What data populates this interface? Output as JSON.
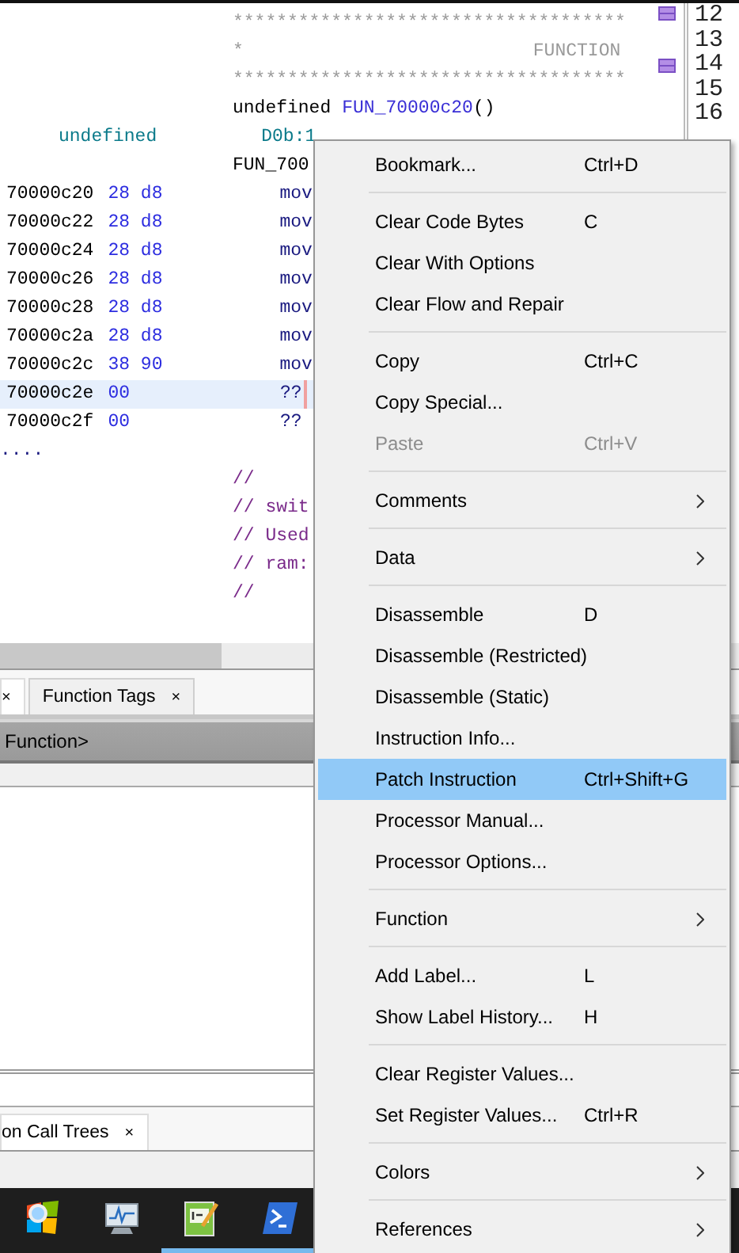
{
  "listing": {
    "rows": [
      {
        "kind": "stars",
        "text": "************************************"
      },
      {
        "kind": "banner",
        "left": "*",
        "title": "FUNCTION"
      },
      {
        "kind": "stars",
        "text": "************************************"
      },
      {
        "kind": "signature",
        "type": "undefined",
        "name": "FUN_70000c20",
        "suffix": "()"
      },
      {
        "kind": "param",
        "type": "undefined",
        "storage": "D0b:1"
      },
      {
        "kind": "label",
        "text": "FUN_700"
      },
      {
        "kind": "instr",
        "address": "70000c20",
        "bytes": "28 d8",
        "mnemonic": "mov",
        "selected": false
      },
      {
        "kind": "instr",
        "address": "70000c22",
        "bytes": "28 d8",
        "mnemonic": "mov",
        "selected": false
      },
      {
        "kind": "instr",
        "address": "70000c24",
        "bytes": "28 d8",
        "mnemonic": "mov",
        "selected": false
      },
      {
        "kind": "instr",
        "address": "70000c26",
        "bytes": "28 d8",
        "mnemonic": "mov",
        "selected": false
      },
      {
        "kind": "instr",
        "address": "70000c28",
        "bytes": "28 d8",
        "mnemonic": "mov",
        "selected": false
      },
      {
        "kind": "instr",
        "address": "70000c2a",
        "bytes": "28 d8",
        "mnemonic": "mov",
        "selected": false
      },
      {
        "kind": "instr",
        "address": "70000c2c",
        "bytes": "38 90",
        "mnemonic": "mov",
        "selected": false
      },
      {
        "kind": "instr",
        "address": "70000c2e",
        "bytes": "00",
        "mnemonic": "??",
        "selected": true
      },
      {
        "kind": "instr",
        "address": "70000c2f",
        "bytes": "00",
        "mnemonic": "??",
        "selected": false
      },
      {
        "kind": "ellipsis",
        "text": "...."
      },
      {
        "kind": "comment",
        "text": "//"
      },
      {
        "kind": "comment",
        "text": "// swit"
      },
      {
        "kind": "comment",
        "text": "// Used"
      },
      {
        "kind": "comment",
        "text": "// ram:"
      },
      {
        "kind": "comment",
        "text": "//"
      }
    ],
    "line_numbers": [
      "12",
      "13",
      "14",
      "15",
      "16"
    ]
  },
  "upper_tabs": [
    {
      "close": "×",
      "selected": true
    },
    {
      "label": "Function Tags",
      "close": "×",
      "selected": false
    }
  ],
  "function_header": "Function>",
  "lower_tabs": [
    {
      "label": "on Call Trees",
      "close": "×",
      "selected": true
    }
  ],
  "taskbar": [
    {
      "kind": "start",
      "running": false
    },
    {
      "kind": "monitor",
      "running": false
    },
    {
      "kind": "notepad",
      "running": true
    },
    {
      "kind": "shell",
      "running": true
    }
  ],
  "context_menu": [
    {
      "kind": "item",
      "label": "Bookmark...",
      "shortcut": "Ctrl+D",
      "submenu": false,
      "disabled": false,
      "selected": false
    },
    {
      "kind": "separator"
    },
    {
      "kind": "item",
      "label": "Clear Code Bytes",
      "shortcut": "C",
      "submenu": false,
      "disabled": false,
      "selected": false
    },
    {
      "kind": "item",
      "label": "Clear With Options",
      "submenu": false,
      "disabled": false,
      "selected": false
    },
    {
      "kind": "item",
      "label": "Clear Flow and Repair",
      "submenu": false,
      "disabled": false,
      "selected": false
    },
    {
      "kind": "separator"
    },
    {
      "kind": "item",
      "label": "Copy",
      "shortcut": "Ctrl+C",
      "submenu": false,
      "disabled": false,
      "selected": false
    },
    {
      "kind": "item",
      "label": "Copy Special...",
      "submenu": false,
      "disabled": false,
      "selected": false
    },
    {
      "kind": "item",
      "label": "Paste",
      "shortcut": "Ctrl+V",
      "submenu": false,
      "disabled": true,
      "selected": false
    },
    {
      "kind": "separator"
    },
    {
      "kind": "item",
      "label": "Comments",
      "submenu": true,
      "disabled": false,
      "selected": false
    },
    {
      "kind": "separator"
    },
    {
      "kind": "item",
      "label": "Data",
      "submenu": true,
      "disabled": false,
      "selected": false
    },
    {
      "kind": "separator"
    },
    {
      "kind": "item",
      "label": "Disassemble",
      "shortcut": "D",
      "submenu": false,
      "disabled": false,
      "selected": false
    },
    {
      "kind": "item",
      "label": "Disassemble (Restricted)",
      "submenu": false,
      "disabled": false,
      "selected": false
    },
    {
      "kind": "item",
      "label": "Disassemble (Static)",
      "submenu": false,
      "disabled": false,
      "selected": false
    },
    {
      "kind": "item",
      "label": "Instruction Info...",
      "submenu": false,
      "disabled": false,
      "selected": false
    },
    {
      "kind": "item",
      "label": "Patch Instruction",
      "shortcut": "Ctrl+Shift+G",
      "submenu": false,
      "disabled": false,
      "selected": true
    },
    {
      "kind": "item",
      "label": "Processor Manual...",
      "submenu": false,
      "disabled": false,
      "selected": false
    },
    {
      "kind": "item",
      "label": "Processor Options...",
      "submenu": false,
      "disabled": false,
      "selected": false
    },
    {
      "kind": "separator"
    },
    {
      "kind": "item",
      "label": "Function",
      "submenu": true,
      "disabled": false,
      "selected": false
    },
    {
      "kind": "separator"
    },
    {
      "kind": "item",
      "label": "Add Label...",
      "shortcut": "L",
      "submenu": false,
      "disabled": false,
      "selected": false
    },
    {
      "kind": "item",
      "label": "Show Label History...",
      "shortcut": "H",
      "submenu": false,
      "disabled": false,
      "selected": false
    },
    {
      "kind": "separator"
    },
    {
      "kind": "item",
      "label": "Clear Register Values...",
      "submenu": false,
      "disabled": false,
      "selected": false
    },
    {
      "kind": "item",
      "label": "Set Register Values...",
      "shortcut": "Ctrl+R",
      "submenu": false,
      "disabled": false,
      "selected": false
    },
    {
      "kind": "separator"
    },
    {
      "kind": "item",
      "label": "Colors",
      "submenu": true,
      "disabled": false,
      "selected": false
    },
    {
      "kind": "separator"
    },
    {
      "kind": "item",
      "label": "References",
      "submenu": true,
      "disabled": false,
      "selected": false
    }
  ]
}
